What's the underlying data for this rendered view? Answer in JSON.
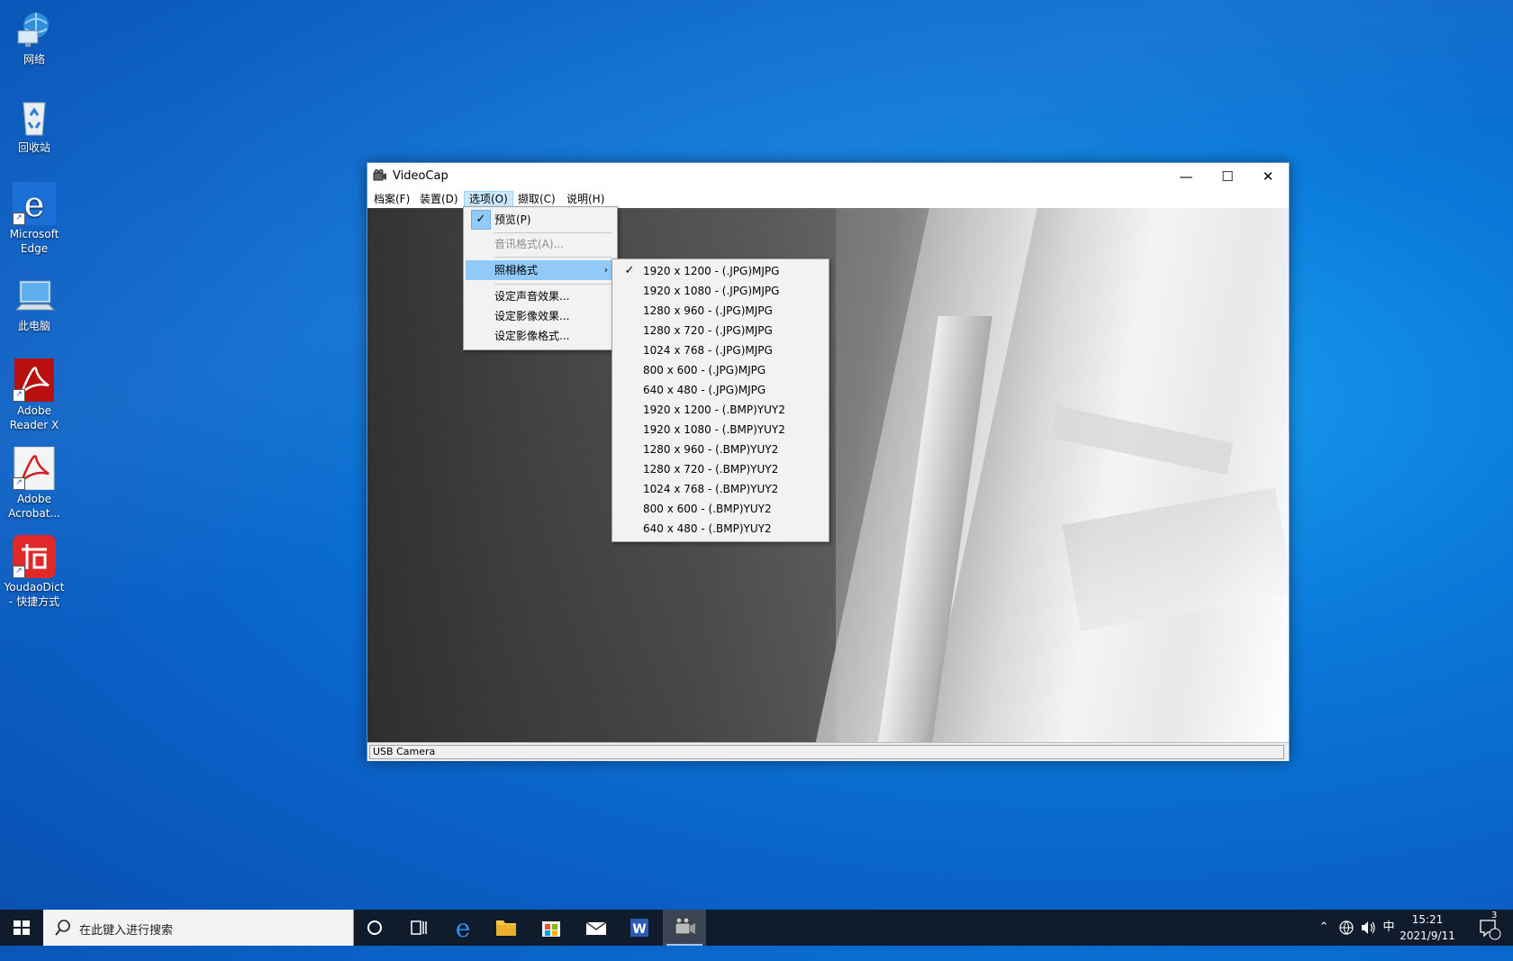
{
  "desktop": {
    "icons": [
      {
        "label": "网络"
      },
      {
        "label": "回收站"
      },
      {
        "label": "Microsoft Edge"
      },
      {
        "label": "此电脑"
      },
      {
        "label": "Adobe Reader X"
      },
      {
        "label": "Adobe Acrobat..."
      },
      {
        "label": "YoudaoDict - 快捷方式"
      }
    ]
  },
  "window": {
    "title": "VideoCap",
    "controls": {
      "minimize": "—",
      "maximize": "☐",
      "close": "✕"
    },
    "menubar": [
      "档案(F)",
      "装置(D)",
      "选项(O)",
      "撷取(C)",
      "说明(H)"
    ],
    "status": "USB Camera"
  },
  "options_menu": {
    "items": [
      {
        "label": "预览(P)",
        "checked": true
      },
      {
        "label": "音讯格式(A)...",
        "disabled": true
      },
      {
        "label": "照相格式",
        "submenu": true,
        "highlighted": true
      },
      {
        "label": "设定声音效果..."
      },
      {
        "label": "设定影像效果..."
      },
      {
        "label": "设定影像格式..."
      }
    ]
  },
  "photo_format_submenu": {
    "items": [
      {
        "label": "1920 x 1200 - (.JPG)MJPG",
        "checked": true
      },
      {
        "label": "1920 x 1080 - (.JPG)MJPG"
      },
      {
        "label": "1280 x 960 - (.JPG)MJPG"
      },
      {
        "label": "1280 x 720 - (.JPG)MJPG"
      },
      {
        "label": "1024 x 768 - (.JPG)MJPG"
      },
      {
        "label": "800 x 600 - (.JPG)MJPG"
      },
      {
        "label": "640 x 480 - (.JPG)MJPG"
      },
      {
        "label": "1920 x 1200 - (.BMP)YUY2"
      },
      {
        "label": "1920 x 1080 - (.BMP)YUY2"
      },
      {
        "label": "1280 x 960 - (.BMP)YUY2"
      },
      {
        "label": "1280 x 720 - (.BMP)YUY2"
      },
      {
        "label": "1024 x 768 - (.BMP)YUY2"
      },
      {
        "label": "800 x 600 - (.BMP)YUY2"
      },
      {
        "label": "640 x 480 - (.BMP)YUY2"
      }
    ]
  },
  "taskbar": {
    "search_placeholder": "在此键入进行搜索",
    "tray": {
      "ime": "中",
      "time": "15:21",
      "date": "2021/9/11",
      "notifications": "3"
    }
  }
}
